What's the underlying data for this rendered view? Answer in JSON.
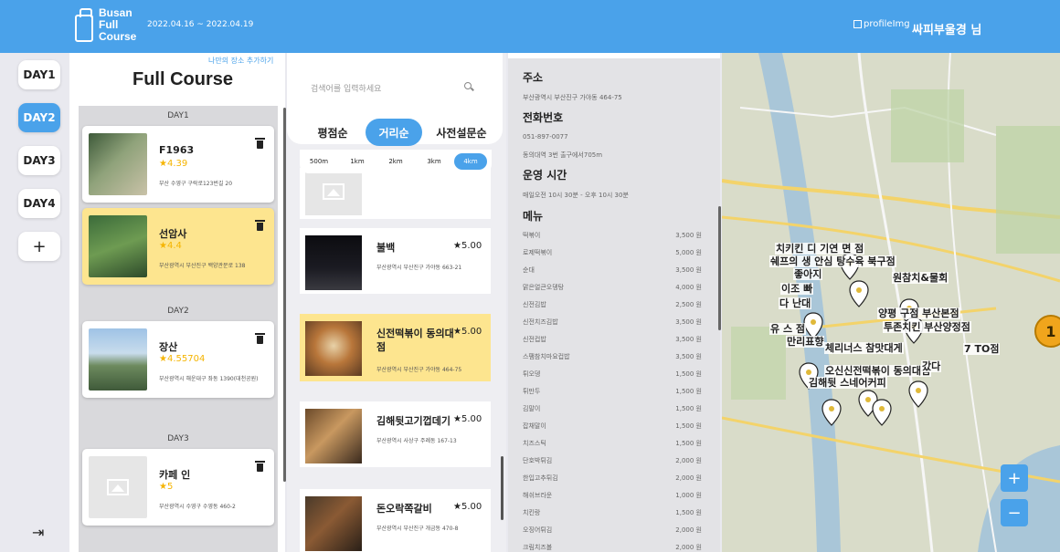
{
  "header": {
    "logo_lines": [
      "Busan",
      "Full",
      "Course"
    ],
    "dates": "2022.04.16 ~ 2022.04.19",
    "profile_img_alt": "profileImg",
    "username": "싸피부울경 님"
  },
  "days": {
    "items": [
      "DAY1",
      "DAY2",
      "DAY3",
      "DAY4"
    ],
    "active": "DAY2",
    "add_label": "+"
  },
  "course": {
    "add_place_link": "나만의 장소 추가하기",
    "title": "Full Course",
    "groups": [
      {
        "day": "DAY1",
        "places": [
          {
            "name": "F1963",
            "rating": "★4.39",
            "address": "부산 수영구 구락로123번길 20",
            "highlight": false
          },
          {
            "name": "선암사",
            "rating": "★4.4",
            "address": "부산광역시 부산진구 백양관문로 138",
            "highlight": true
          }
        ]
      },
      {
        "day": "DAY2",
        "places": [
          {
            "name": "장산",
            "rating": "★4.55704",
            "address": "부산광역시 해운대구 좌동 1390(대천공원)",
            "highlight": false
          }
        ]
      },
      {
        "day": "DAY3",
        "places": [
          {
            "name": "카페 인",
            "rating": "★5",
            "address": "부산광역시 수영구 수영동 460-2",
            "highlight": false
          }
        ]
      }
    ]
  },
  "search": {
    "placeholder": "검색어를 입력하세요",
    "sort_tabs": [
      "평점순",
      "거리순",
      "사전설문순"
    ],
    "active_sort": "거리순",
    "distances": [
      "500m",
      "1km",
      "2km",
      "3km",
      "4km"
    ],
    "active_distance": "4km",
    "results": [
      {
        "name": "불백",
        "rating": "★5.00",
        "address": "부산광역시 부산진구 가야동 663-21",
        "highlight": false
      },
      {
        "name": "신전떡볶이 동의대점",
        "rating": "★5.00",
        "address": "부산광역시 부산진구 가야동 464-75",
        "highlight": true
      },
      {
        "name": "김해뒷고기껍데기",
        "rating": "★5.00",
        "address": "부산광역시 사상구 주례동 167-13",
        "highlight": false
      },
      {
        "name": "돈오락쪽갈비",
        "rating": "★5.00",
        "address": "부산광역시 부산진구 개금동 470-8",
        "highlight": false
      }
    ]
  },
  "detail": {
    "address_heading": "주소",
    "address": "부산광역시 부산진구 가야동 464-75",
    "phone_heading": "전화번호",
    "phone": "051-897-0077",
    "directions": "동의대역 3번 출구에서705m",
    "hours_heading": "운영 시간",
    "hours": "매일오전 10시 30분 - 오후 10시 30분",
    "menu_heading": "메뉴",
    "menu": [
      {
        "item": "떡볶이",
        "price": "3,500 원"
      },
      {
        "item": "로제떡볶이",
        "price": "5,000 원"
      },
      {
        "item": "순대",
        "price": "3,500 원"
      },
      {
        "item": "맑은얼큰오뎅탕",
        "price": "4,000 원"
      },
      {
        "item": "신전김밥",
        "price": "2,500 원"
      },
      {
        "item": "신전치즈김밥",
        "price": "3,500 원"
      },
      {
        "item": "신전컵밥",
        "price": "3,500 원"
      },
      {
        "item": "스팸참치마요컵밥",
        "price": "3,500 원"
      },
      {
        "item": "튀오뎅",
        "price": "1,500 원"
      },
      {
        "item": "튀만두",
        "price": "1,500 원"
      },
      {
        "item": "김말이",
        "price": "1,500 원"
      },
      {
        "item": "잡채말이",
        "price": "1,500 원"
      },
      {
        "item": "치즈스틱",
        "price": "1,500 원"
      },
      {
        "item": "단호박튀김",
        "price": "2,000 원"
      },
      {
        "item": "한입고추튀김",
        "price": "2,000 원"
      },
      {
        "item": "해쉬브라운",
        "price": "1,000 원"
      },
      {
        "item": "치킨랑",
        "price": "1,500 원"
      },
      {
        "item": "오징어튀김",
        "price": "2,000 원"
      },
      {
        "item": "크림치즈볼",
        "price": "2,000 원"
      }
    ]
  },
  "map": {
    "labels": [
      "치키킨 디 기연 면 점",
      "쉐프의 생 안심 탕수육 북구점",
      "좋아지",
      "원참치&물회",
      "이조 빠",
      "다 난대",
      "양평 구점 부산본점",
      "유 스 점",
      "투존치킨 부산양정점",
      "만리표향",
      "체리너스 참맛대게",
      "7 TO점",
      "오신신전떡볶이 동의대점",
      "김해뒷 스네어커피",
      "갔다"
    ],
    "zoom_in": "+",
    "zoom_out": "−",
    "cluster_badge": "1"
  },
  "logout_icon": "logout-icon"
}
